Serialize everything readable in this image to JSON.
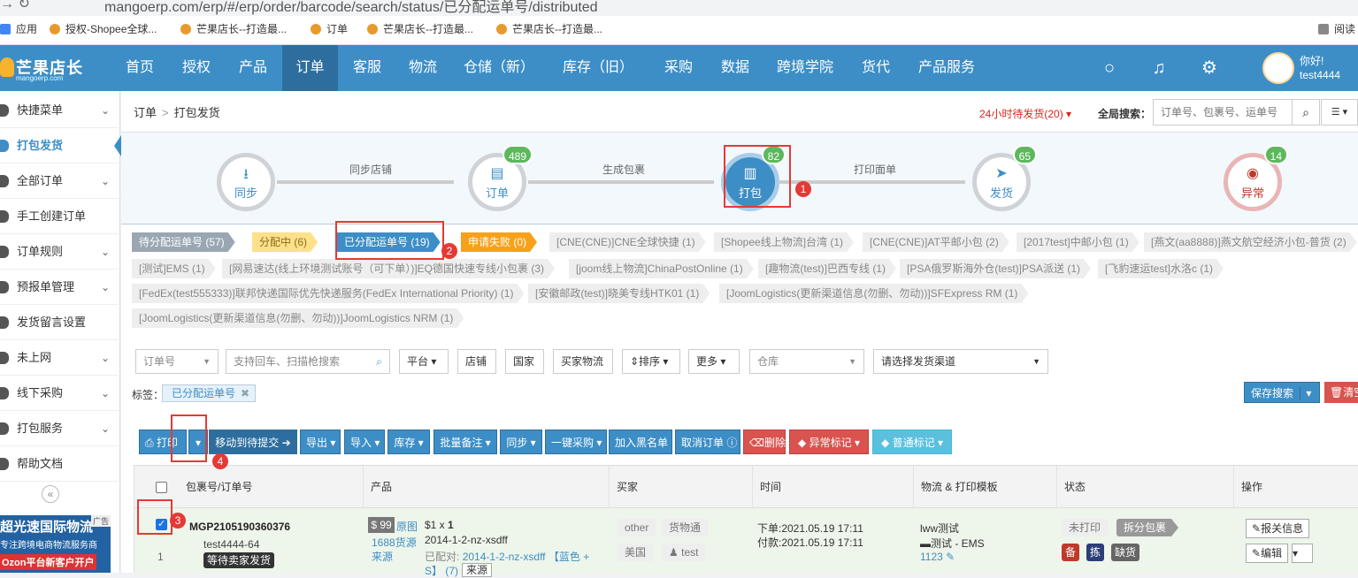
{
  "browser": {
    "url": "mangoerp.com/erp/#/erp/order/barcode/search/status/已分配运单号/distributed",
    "bookmarks": [
      "应用",
      "授权-Shopee全球...",
      "芒果店长--打造最...",
      "订单",
      "芒果店长--打造最...",
      "芒果店长--打造最..."
    ],
    "reading_list": "阅读"
  },
  "brand": {
    "name": "芒果店长",
    "domain": "mangoerp.com"
  },
  "nav": {
    "items": [
      "首页",
      "授权",
      "产品",
      "订单",
      "客服",
      "物流",
      "仓储（新）",
      "库存（旧）",
      "采购",
      "数据",
      "跨境学院",
      "货代",
      "产品服务"
    ],
    "active": "订单",
    "greeting": "你好!",
    "username": "test4444"
  },
  "sidebar": {
    "items": [
      {
        "label": "快捷菜单",
        "chevron": "⌄"
      },
      {
        "label": "打包发货",
        "chevron": ""
      },
      {
        "label": "全部订单",
        "chevron": "⌄"
      },
      {
        "label": "手工创建订单",
        "chevron": ""
      },
      {
        "label": "订单规则",
        "chevron": "⌄"
      },
      {
        "label": "预报单管理",
        "chevron": "⌄"
      },
      {
        "label": "发货留言设置",
        "chevron": ""
      },
      {
        "label": "未上网",
        "chevron": "⌄"
      },
      {
        "label": "线下采购",
        "chevron": "⌄"
      },
      {
        "label": "打包服务",
        "chevron": "⌄"
      },
      {
        "label": "帮助文档",
        "chevron": ""
      }
    ],
    "collapse": "«"
  },
  "ad": {
    "line1": "超光速国际物流",
    "line2": "专注跨境电商物流服务商",
    "line3": "Ozon平台新客户开户",
    "tag": "广告"
  },
  "breadcrumb": {
    "root": "订单",
    "sep": ">",
    "current": "打包发货"
  },
  "pending": "24小时待发货(20)",
  "global_search": {
    "label": "全局搜索：",
    "placeholder": "订单号、包裹号、运单号"
  },
  "steps": [
    {
      "label": "同步",
      "count": "",
      "icon": "⭳"
    },
    {
      "label": "订单",
      "count": "489",
      "icon": "▤"
    },
    {
      "label": "打包",
      "count": "82",
      "icon": "▥"
    },
    {
      "label": "发货",
      "count": "65",
      "icon": "➤"
    },
    {
      "label": "异常",
      "count": "14",
      "icon": "◉"
    }
  ],
  "step_links": [
    "同步店铺",
    "生成包裹",
    "打印面单"
  ],
  "markers": [
    "1",
    "2",
    "3",
    "4"
  ],
  "status_tabs": [
    {
      "label": "待分配运单号 (57)"
    },
    {
      "label": "分配中 (6)"
    },
    {
      "label": "已分配运单号 (19)"
    },
    {
      "label": "申请失败 (0)"
    }
  ],
  "channels": [
    "[CNE(CNE)]CNE全球快捷 (1)",
    "[Shopee线上物流]台湾 (1)",
    "[CNE(CNE)]AT平邮小包 (2)",
    "[2017test]中邮小包 (1)",
    "[燕文(aa8888)]燕文航空经济小包-普货 (2)",
    "[测试]EMS (1)",
    "[网易速达(线上环境测试账号（可下单）)]EQ德国快速专线小包裹 (3)",
    "[joom线上物流]ChinaPostOnline (1)",
    "[趣物流(test)]巴西专线 (1)",
    "[PSA俄罗斯海外仓(test)]PSA派送 (1)",
    "[飞豹速运test]水洛c (1)",
    "[FedEx(test555333)]联邦快递国际优先快递服务(FedEx International Priority) (1)",
    "[安徽邮政(test)]晓美专线HTK01 (1)",
    "[JoomLogistics(更新渠道信息(勿删、勿动))]SFExpress RM (1)",
    "[JoomLogistics(更新渠道信息(勿删、勿动))]JoomLogistics NRM (1)"
  ],
  "filters": {
    "order_select": "订单号",
    "search_placeholder": "支持回车、扫描枪搜索",
    "platform": "平台",
    "shop": "店铺",
    "country": "国家",
    "buyer_logistics": "买家物流",
    "sort": "⇕排序",
    "more": "更多",
    "warehouse_placeholder": "仓库",
    "channel_placeholder": "请选择发货渠道"
  },
  "tag_filter": {
    "label": "标签：",
    "value": "已分配运单号",
    "remove": "✖"
  },
  "save_search": "保存搜索",
  "clear": "清空",
  "actions": {
    "print": "打印",
    "caret": "▾",
    "move": "移动到待提交",
    "export": "导出",
    "import": "导入",
    "stock": "库存",
    "batch_note": "批量备注",
    "sync": "同步",
    "purchase": "一键采购",
    "blacklist": "加入黑名单",
    "cancel": "取消订单",
    "delete": "删除",
    "abnormal": "异常标记",
    "normal": "普通标记"
  },
  "table": {
    "headers": [
      "包裹号/订单号",
      "产品",
      "买家",
      "时间",
      "物流 & 打印模板",
      "状态",
      "操作"
    ],
    "row": {
      "index": "1",
      "package_no": "MGP2105190360376",
      "order_no": "test4444-64",
      "waiting": "等待卖家发货",
      "price": "$ 99",
      "link1": "原图",
      "link2": "1688货源",
      "link3": "来源",
      "qty_prefix": "$1 x",
      "qty": "1",
      "sku": "2014-1-2-nz-xsdff",
      "matched_label": "已配对:",
      "matched_sku": "2014-1-2-nz-xsdff",
      "matched_color": "【蓝色 +",
      "matched_tail": "S】 (7)",
      "source_btn": "来源",
      "buyer_other": "other",
      "buyer_logistics": "货物通",
      "buyer_country": "美国",
      "buyer_user": "test",
      "order_time": "下单:2021.05.19 17:11",
      "pay_time": "付款:2021.05.19 17:11",
      "logistics": "lww测试",
      "logistics_ch": "测试 - EMS",
      "tracking": "1123",
      "status_print": "未打印",
      "status_split": "拆分包裹",
      "flag1": "备",
      "flag2": "拣",
      "flag3": "缺货",
      "op_customs": "报关信息",
      "op_edit": "编辑"
    }
  },
  "colors": {
    "primary": "#3d8ec6",
    "nav_active": "#2d6e9e",
    "danger": "#d9534f",
    "success": "#5cb85c",
    "warning": "#f7a11a"
  }
}
